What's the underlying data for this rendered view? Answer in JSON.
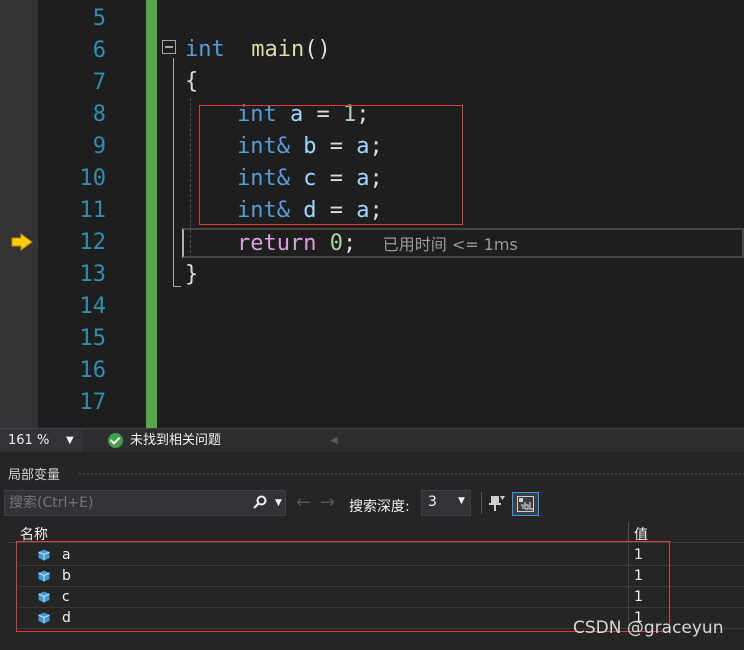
{
  "editor": {
    "line_numbers": [
      "5",
      "6",
      "7",
      "8",
      "9",
      "10",
      "11",
      "12",
      "13",
      "14",
      "15",
      "16",
      "17"
    ],
    "code": {
      "l6": {
        "kw": "int",
        "fn": "main",
        "punc": "()"
      },
      "l7": {
        "punc": "{"
      },
      "l8": {
        "kw": "int",
        "var": "a",
        "op": " = ",
        "num": "1",
        "end": ";"
      },
      "l9": {
        "kw": "int&",
        "var": "b",
        "op": " = ",
        "rhs": "a",
        "end": ";"
      },
      "l10": {
        "kw": "int&",
        "var": "c",
        "op": " = ",
        "rhs": "a",
        "end": ";"
      },
      "l11": {
        "kw": "int&",
        "var": "d",
        "op": " = ",
        "rhs": "a",
        "end": ";"
      },
      "l12": {
        "kw": "return",
        "num": "0",
        "end": ";",
        "hint": "已用时间 <= 1ms"
      },
      "l13": {
        "punc": "}"
      }
    }
  },
  "status": {
    "zoom": "161 %",
    "issues": "未找到相关问题"
  },
  "locals": {
    "title": "局部变量",
    "search_placeholder": "搜索(Ctrl+E)",
    "search_depth_label": "搜索深度:",
    "search_depth_value": "3",
    "col_name": "名称",
    "col_value": "值",
    "rows": [
      {
        "name": "a",
        "value": "1"
      },
      {
        "name": "b",
        "value": "1"
      },
      {
        "name": "c",
        "value": "1"
      },
      {
        "name": "d",
        "value": "1"
      }
    ]
  },
  "watermark": "CSDN @graceyun",
  "colors": {
    "keyword": "#569cd6",
    "function": "#dcdcaa",
    "variable": "#9cdcfe",
    "number": "#b5cea8",
    "control": "#d8a0df",
    "line_number": "#2b91af",
    "change_bar": "#57a64a",
    "highlight_box": "#e03a3a"
  },
  "icons": [
    "current-statement-arrow-icon",
    "collapse-icon",
    "success-check-icon",
    "search-icon",
    "back-arrow-icon",
    "forward-arrow-icon",
    "pin-filter-icon",
    "hex-display-icon",
    "variable-icon"
  ]
}
